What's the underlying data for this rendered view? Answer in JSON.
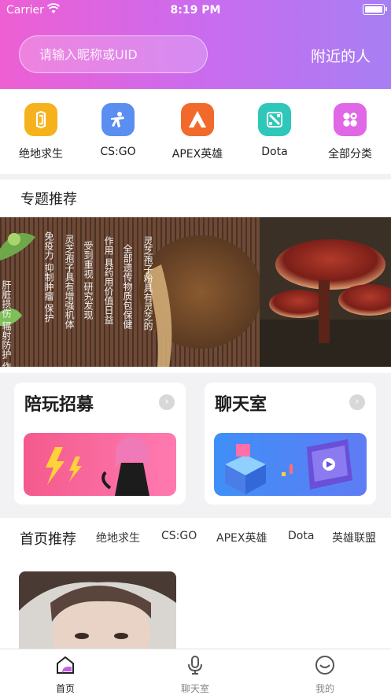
{
  "status": {
    "carrier": "Carrier",
    "time": "8:19 PM"
  },
  "header": {
    "search_placeholder": "请输入昵称或UID",
    "nearby_label": "附近的人"
  },
  "categories": [
    {
      "label": "绝地求生",
      "icon": "pubg-icon",
      "color": "#f6b21c"
    },
    {
      "label": "CS:GO",
      "icon": "csgo-icon",
      "color": "#5a8ef0"
    },
    {
      "label": "APEX英雄",
      "icon": "apex-icon",
      "color": "#f26a2b"
    },
    {
      "label": "Dota",
      "icon": "dota-icon",
      "color": "#2ec7b9"
    },
    {
      "label": "全部分类",
      "icon": "all-categories-icon",
      "color": "#e067e6"
    }
  ],
  "topic": {
    "title": "专题推荐",
    "banner_text": {
      "col1": "肝脏损伤 辐射防护 作用",
      "col2": "免疫力 抑制肿瘤 保护",
      "col3": "灵芝孢子具有增强机体",
      "col4": "受到重视 研究发现",
      "col5": "作用 具药用价值日益",
      "col6": "全部遗传物质包保健",
      "col7": "灵芝孢子粉具有灵芝的"
    }
  },
  "cards": [
    {
      "title": "陪玩招募",
      "image": "companion-recruit-illustration"
    },
    {
      "title": "聊天室",
      "image": "chatroom-illustration"
    }
  ],
  "recommend": {
    "tabs": [
      "首页推荐",
      "绝地求生",
      "CS:GO",
      "APEX英雄",
      "Dota",
      "英雄联盟"
    ]
  },
  "tabbar": [
    {
      "label": "首页",
      "icon": "home-icon",
      "active": true
    },
    {
      "label": "聊天室",
      "icon": "microphone-icon",
      "active": false
    },
    {
      "label": "我的",
      "icon": "smiley-icon",
      "active": false
    }
  ],
  "colors": {
    "accent_start": "#ee5fd3",
    "accent_end": "#a77ff2",
    "active_tab": "#222222"
  }
}
